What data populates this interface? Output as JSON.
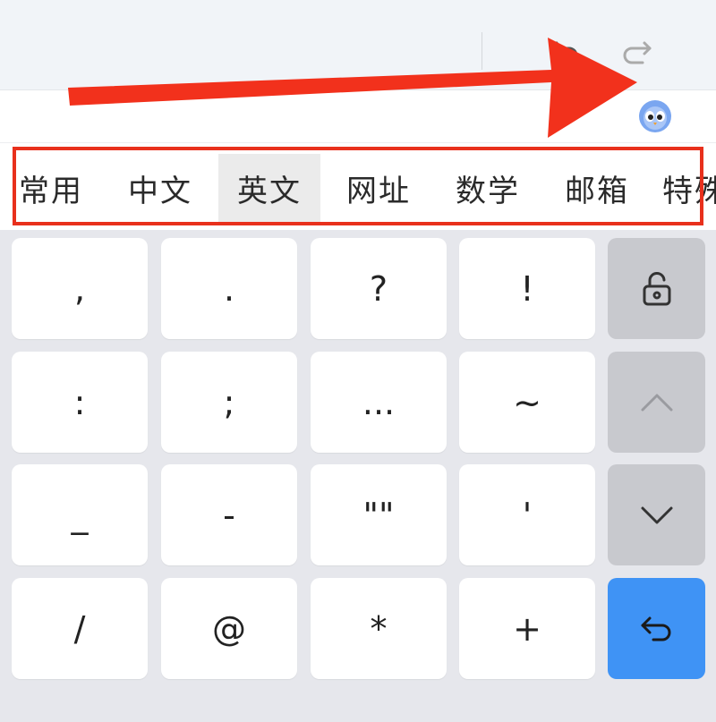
{
  "categories": [
    {
      "label": "常用",
      "selected": false
    },
    {
      "label": "中文",
      "selected": false
    },
    {
      "label": "英文",
      "selected": true
    },
    {
      "label": "网址",
      "selected": false
    },
    {
      "label": "数学",
      "selected": false
    },
    {
      "label": "邮箱",
      "selected": false
    },
    {
      "label": "特殊",
      "selected": false
    }
  ],
  "keys": [
    [
      ",",
      ".",
      "?",
      "!"
    ],
    [
      ":",
      ";",
      "...",
      "~"
    ],
    [
      "_",
      "-",
      "\"\"",
      "'"
    ],
    [
      "/",
      "@",
      "*",
      "+"
    ]
  ],
  "function_keys": [
    "lock-icon",
    "chevron-up-icon",
    "chevron-down-icon",
    "enter-icon"
  ],
  "toolbar_icons": [
    "undo-icon",
    "redo-icon",
    "mascot-icon"
  ],
  "colors": {
    "annotation_red": "#e8301c",
    "enter_key_blue": "#3f93f5",
    "keyboard_bg": "#e6e7ec",
    "function_key_gray": "#c8c9ce",
    "selected_tab_bg": "#ebebeb"
  }
}
